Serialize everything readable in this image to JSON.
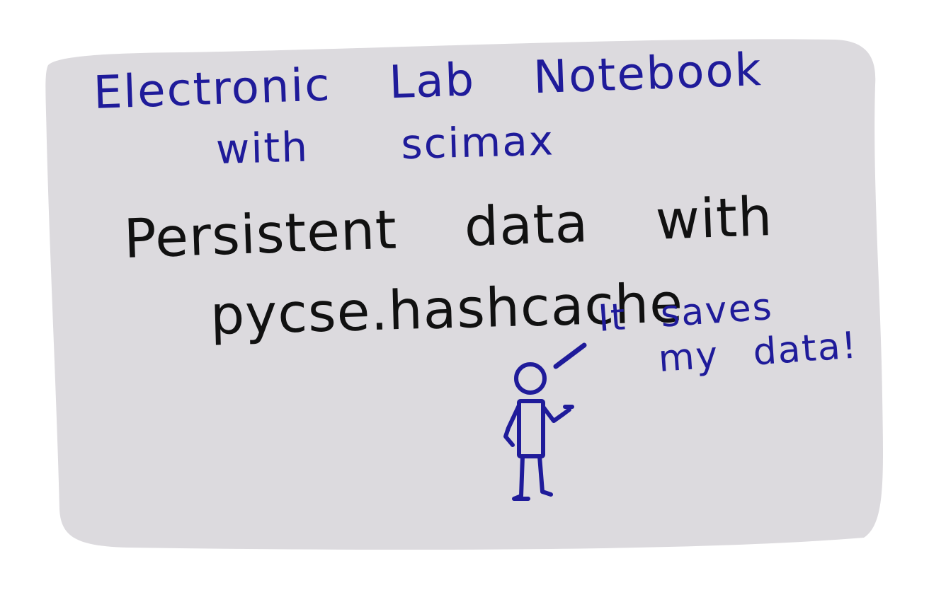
{
  "colors": {
    "page_background": "#ffffff",
    "card_fill": "#dcdade",
    "blue_ink": "#1f1b9a",
    "black_ink": "#111111"
  },
  "title": {
    "line1": "Electronic Lab Notebook",
    "line2": "with scimax"
  },
  "headline": {
    "line1": "Persistent data with",
    "line2": "pycse.hashcache"
  },
  "speech_bubble": {
    "line1": "It saves",
    "line2": "my data!"
  },
  "icons": {
    "figure": "stick-figure-icon",
    "speech_mark": "speech-line-icon"
  }
}
